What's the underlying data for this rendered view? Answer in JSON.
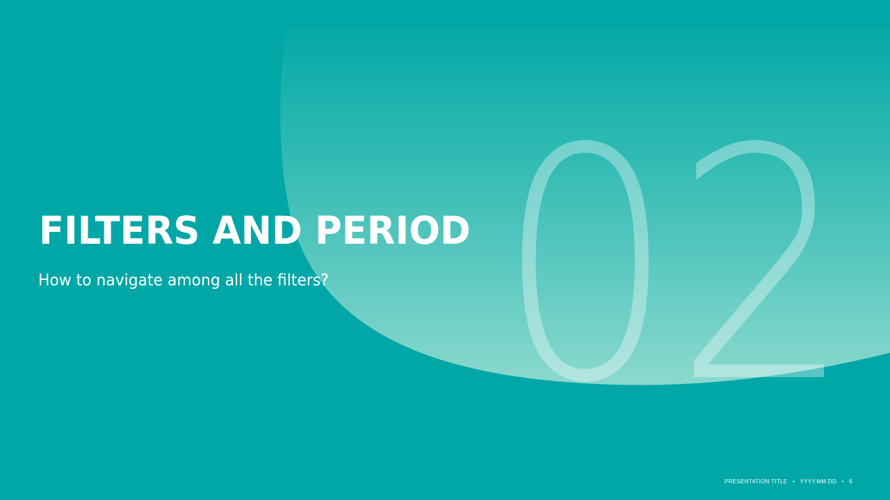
{
  "slide": {
    "title": "FILTERS AND PERIOD",
    "subtitle": "How to navigate among all the filters?",
    "section_number": "02"
  },
  "footer": {
    "presentation_title": "PRESENTATION  TITLE",
    "separator": "•",
    "date": "YYYY.MM.DD",
    "page_number": "6"
  },
  "colors": {
    "background": "#01a7a6",
    "shape_top": "#0aaaa9",
    "shape_bottom": "#8ad9cf",
    "number": "#ffffff",
    "text": "#ffffff"
  }
}
